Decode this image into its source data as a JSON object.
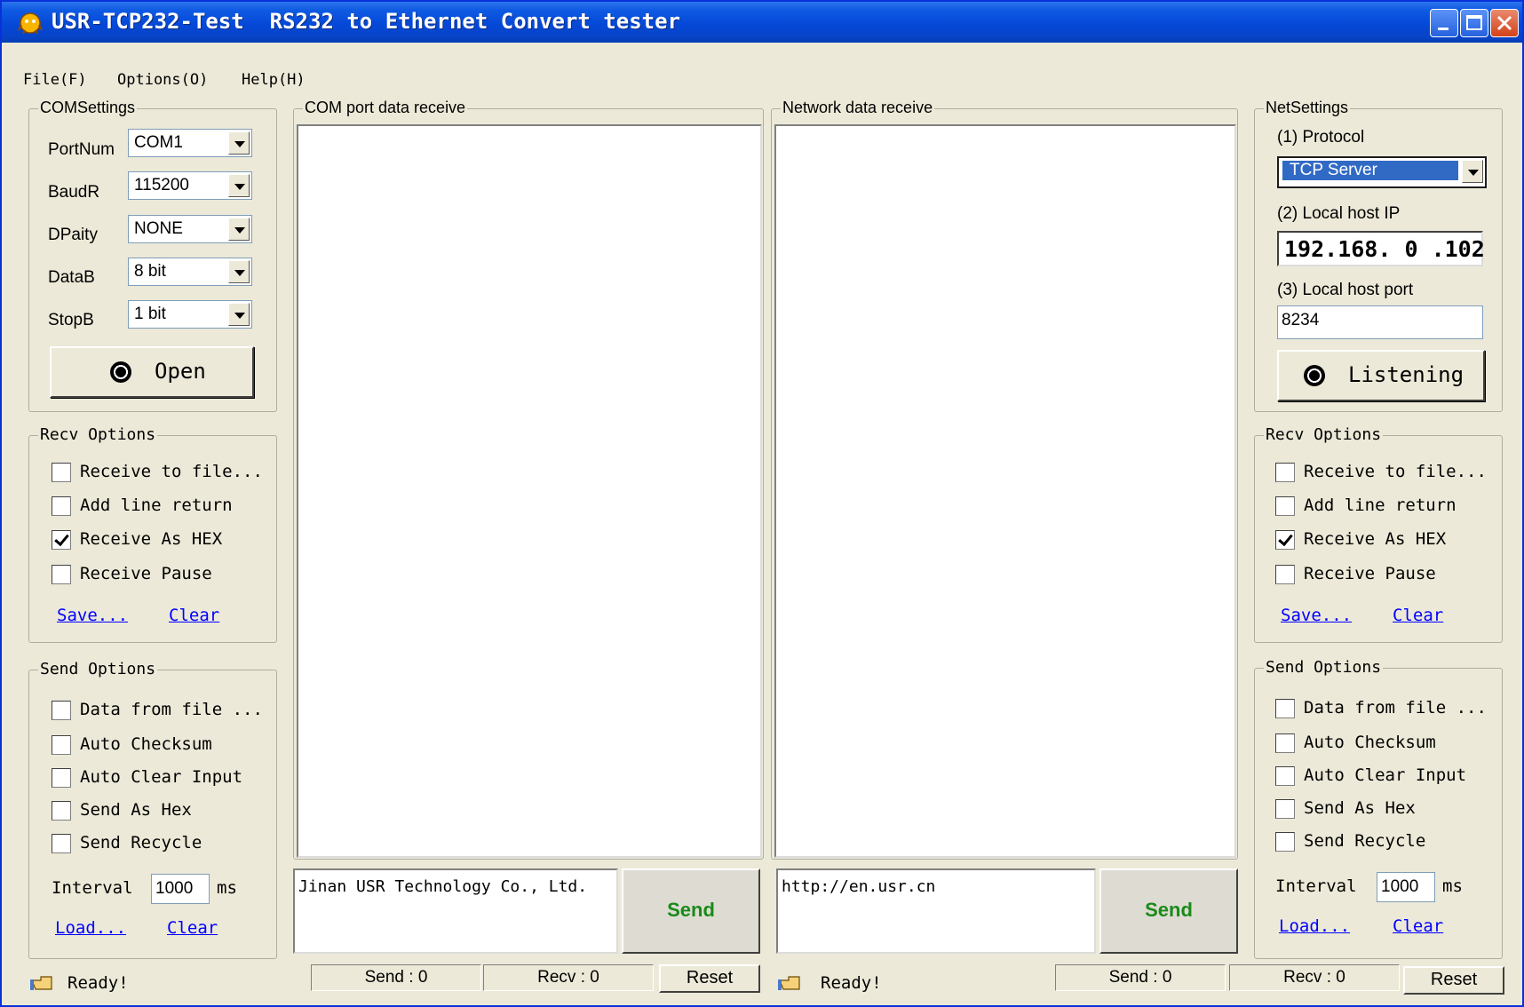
{
  "window": {
    "app_name": "USR-TCP232-Test",
    "subtitle": "RS232 to Ethernet Convert tester"
  },
  "menu": [
    "File(F)",
    "Options(O)",
    "Help(H)"
  ],
  "com_settings": {
    "title": "COMSettings",
    "fields": [
      {
        "label": "PortNum",
        "value": "COM1"
      },
      {
        "label": "BaudR",
        "value": "115200"
      },
      {
        "label": "DPaity",
        "value": "NONE"
      },
      {
        "label": "DataB",
        "value": "8 bit"
      },
      {
        "label": "StopB",
        "value": "1 bit"
      }
    ],
    "open_label": "Open"
  },
  "com_recv": {
    "title": "Recv Options",
    "options": [
      {
        "label": "Receive to file...",
        "checked": false
      },
      {
        "label": "Add line return",
        "checked": false
      },
      {
        "label": "Receive As HEX",
        "checked": true
      },
      {
        "label": "Receive Pause",
        "checked": false
      }
    ],
    "save_link": "Save...",
    "clear_link": "Clear"
  },
  "com_send": {
    "title": "Send Options",
    "options": [
      {
        "label": "Data from file ...",
        "checked": false
      },
      {
        "label": "Auto Checksum",
        "checked": false
      },
      {
        "label": "Auto Clear Input",
        "checked": false
      },
      {
        "label": "Send As Hex",
        "checked": false
      },
      {
        "label": "Send Recycle",
        "checked": false
      }
    ],
    "interval_label": "Interval",
    "interval_value": "1000",
    "interval_unit": "ms",
    "load_link": "Load...",
    "clear_link": "Clear"
  },
  "com_panel": {
    "title": "COM port data receive",
    "send_text": "Jinan USR Technology Co., Ltd.",
    "send_button": "Send"
  },
  "net_panel": {
    "title": "Network data receive",
    "send_text": "http://en.usr.cn",
    "send_button": "Send"
  },
  "net_settings": {
    "title": "NetSettings",
    "protocol_label": "(1) Protocol",
    "protocol_value": "TCP Server",
    "ip_label": "(2) Local host IP",
    "ip_value": "192.168. 0 .102",
    "port_label": "(3) Local host port",
    "port_value": "8234",
    "listen_label": "Listening"
  },
  "net_recv": {
    "title": "Recv Options",
    "options": [
      {
        "label": "Receive to file...",
        "checked": false
      },
      {
        "label": "Add line return",
        "checked": false
      },
      {
        "label": "Receive As HEX",
        "checked": true
      },
      {
        "label": "Receive Pause",
        "checked": false
      }
    ],
    "save_link": "Save...",
    "clear_link": "Clear"
  },
  "net_send": {
    "title": "Send Options",
    "options": [
      {
        "label": "Data from file ...",
        "checked": false
      },
      {
        "label": "Auto Checksum",
        "checked": false
      },
      {
        "label": "Auto Clear Input",
        "checked": false
      },
      {
        "label": "Send As Hex",
        "checked": false
      },
      {
        "label": "Send Recycle",
        "checked": false
      }
    ],
    "interval_label": "Interval",
    "interval_value": "1000",
    "interval_unit": "ms",
    "load_link": "Load...",
    "clear_link": "Clear"
  },
  "status": {
    "com_ready": "Ready!",
    "com_send": "Send : 0",
    "com_recv": "Recv : 0",
    "com_reset": "Reset",
    "net_ready": "Ready!",
    "net_send": "Send : 0",
    "net_recv": "Recv : 0",
    "net_reset": "Reset"
  }
}
